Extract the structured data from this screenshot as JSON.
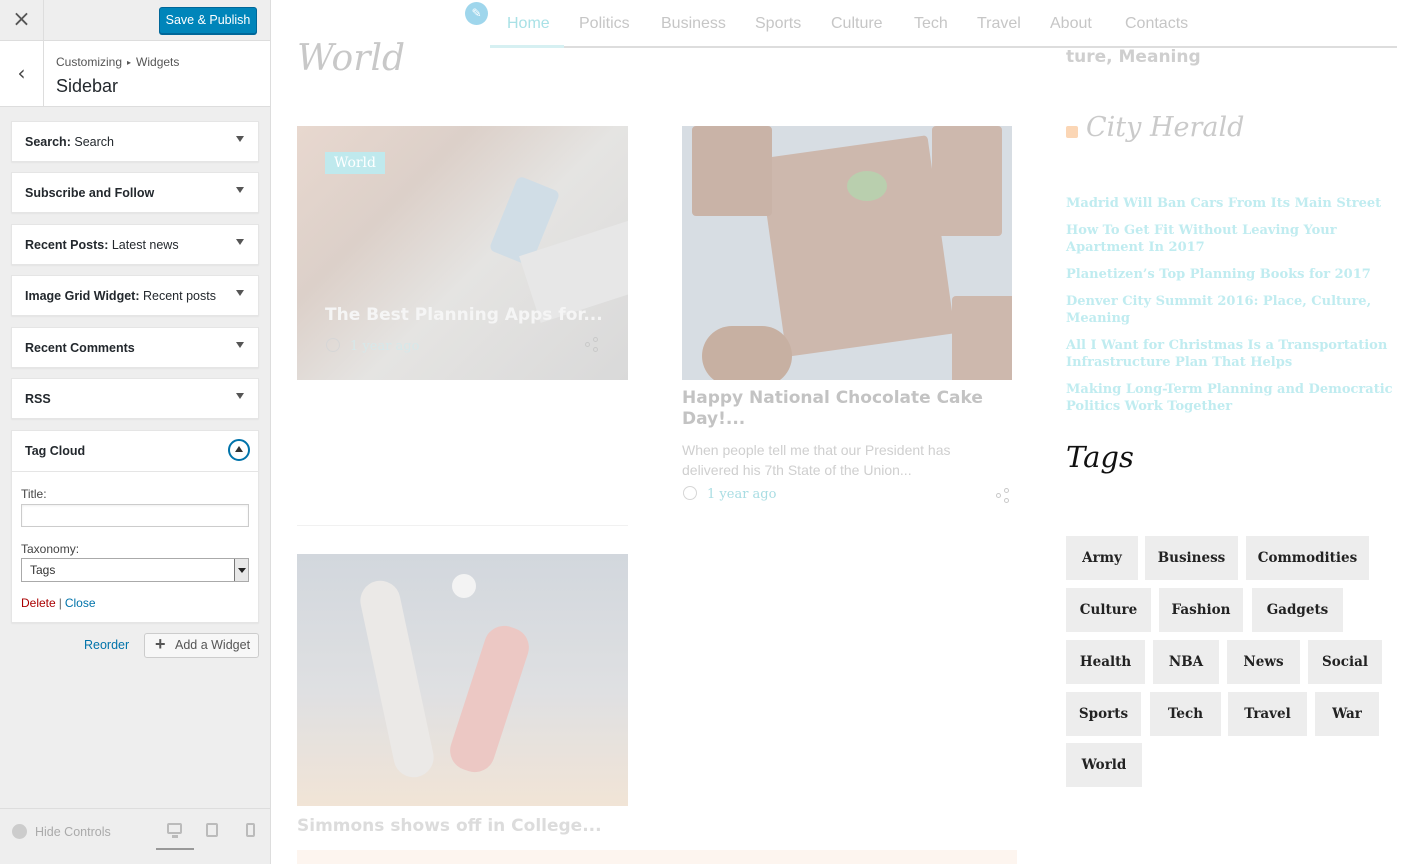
{
  "customizer": {
    "close_icon": "×",
    "save_label": "Save & Publish",
    "back_icon": "‹",
    "breadcrumb": [
      "Customizing",
      "Widgets"
    ],
    "breadcrumb_sep": "▸",
    "section_title": "Sidebar",
    "widgets": [
      {
        "name": "Search",
        "title": "Search"
      },
      {
        "name": "Subscribe and Follow",
        "title": ""
      },
      {
        "name": "Recent Posts",
        "title": "Latest news"
      },
      {
        "name": "Image Grid Widget",
        "title": "Recent posts"
      },
      {
        "name": "Recent Comments",
        "title": ""
      },
      {
        "name": "RSS",
        "title": ""
      }
    ],
    "open_widget": {
      "name": "Tag Cloud",
      "title_label": "Title:",
      "title_value": "",
      "taxonomy_label": "Taxonomy:",
      "taxonomy_value": "Tags",
      "delete_label": "Delete",
      "separator": "|",
      "close_label": "Close"
    },
    "reorder_label": "Reorder",
    "add_widget_label": "Add a Widget",
    "add_icon": "+",
    "hide_controls_label": "Hide Controls",
    "accent_color": "#0085ba"
  },
  "preview": {
    "edit_icon": "✎",
    "nav": [
      "Home",
      "Politics",
      "Business",
      "Sports",
      "Culture",
      "Tech",
      "Travel",
      "About",
      "Contacts"
    ],
    "active_nav": "Home",
    "page_title": "World",
    "card1": {
      "category": "World",
      "title": "The Best Planning Apps for...",
      "time": "1 year ago"
    },
    "card2": {
      "title": "Happy National Chocolate Cake Day!...",
      "excerpt": "When people tell me that our President has delivered his 7th State of the Union...",
      "time": "1 year ago"
    },
    "card3": {
      "title": "Simmons shows off in College..."
    },
    "sidebar_prev_text": "ture, Meaning",
    "rss": {
      "title": "City Herald",
      "items": [
        "Madrid Will Ban Cars From Its Main Street",
        "How To Get Fit Without Leaving Your Apartment In 2017",
        "Planetizen’s Top Planning Books for 2017",
        "Denver City Summit 2016: Place, Culture, Meaning",
        "All I Want for Christmas Is a Transportation Infrastructure Plan That Helps",
        "Making Long-Term Planning and Democratic Politics Work Together"
      ]
    },
    "tags_title": "Tags",
    "tags": [
      "Army",
      "Business",
      "Commodities",
      "Culture",
      "Fashion",
      "Gadgets",
      "Health",
      "NBA",
      "News",
      "Social",
      "Sports",
      "Tech",
      "Travel",
      "War",
      "World"
    ]
  }
}
